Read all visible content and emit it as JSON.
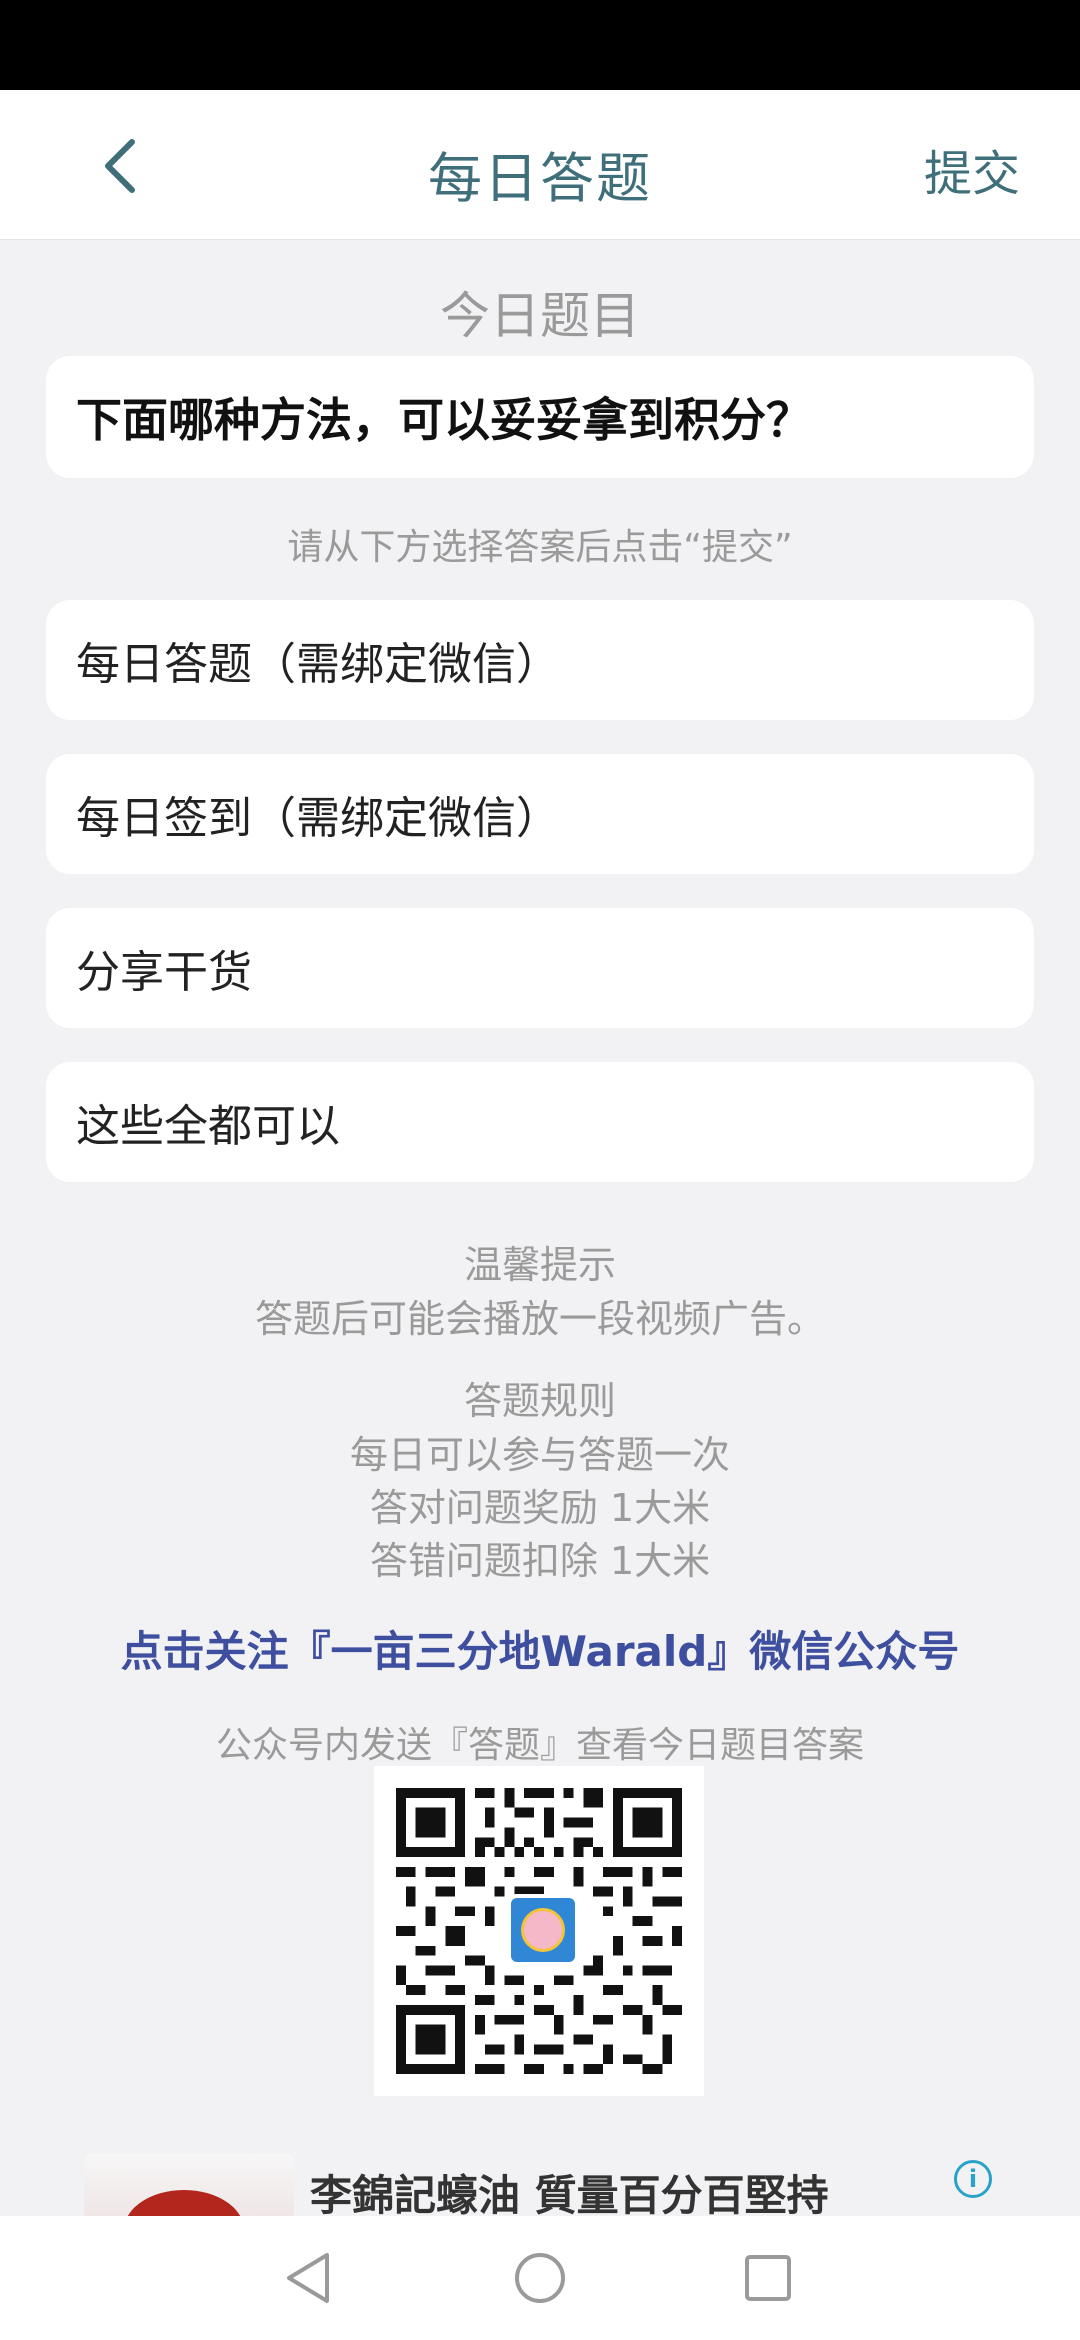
{
  "header": {
    "title": "每日答题",
    "submit_label": "提交",
    "back_icon": "chevron-left-icon"
  },
  "question": {
    "section_label": "今日题目",
    "text": "下面哪种方法，可以妥妥拿到积分？",
    "hint": "请从下方选择答案后点击“提交”",
    "options": [
      {
        "label": "每日答题（需绑定微信）"
      },
      {
        "label": "每日签到（需绑定微信）"
      },
      {
        "label": "分享干货"
      },
      {
        "label": "这些全都可以"
      }
    ]
  },
  "tips": {
    "title": "温馨提示",
    "text": "答题后可能会播放一段视频广告。"
  },
  "rules": {
    "title": "答题规则",
    "lines": [
      "每日可以参与答题一次",
      "答对问题奖励 1大米",
      "答错问题扣除 1大米"
    ]
  },
  "follow": {
    "link_text": "点击关注『一亩三分地Warald』微信公众号",
    "send_hint": "公众号内发送『答题』查看今日题目答案"
  },
  "ad": {
    "title": "李錦記蠔油 質量百分百堅持",
    "info_icon": "info-icon"
  },
  "colors": {
    "accent": "#3e6f7a",
    "link": "#3d4f9e",
    "muted": "#9a9a9a",
    "background": "#f2f2f4"
  }
}
